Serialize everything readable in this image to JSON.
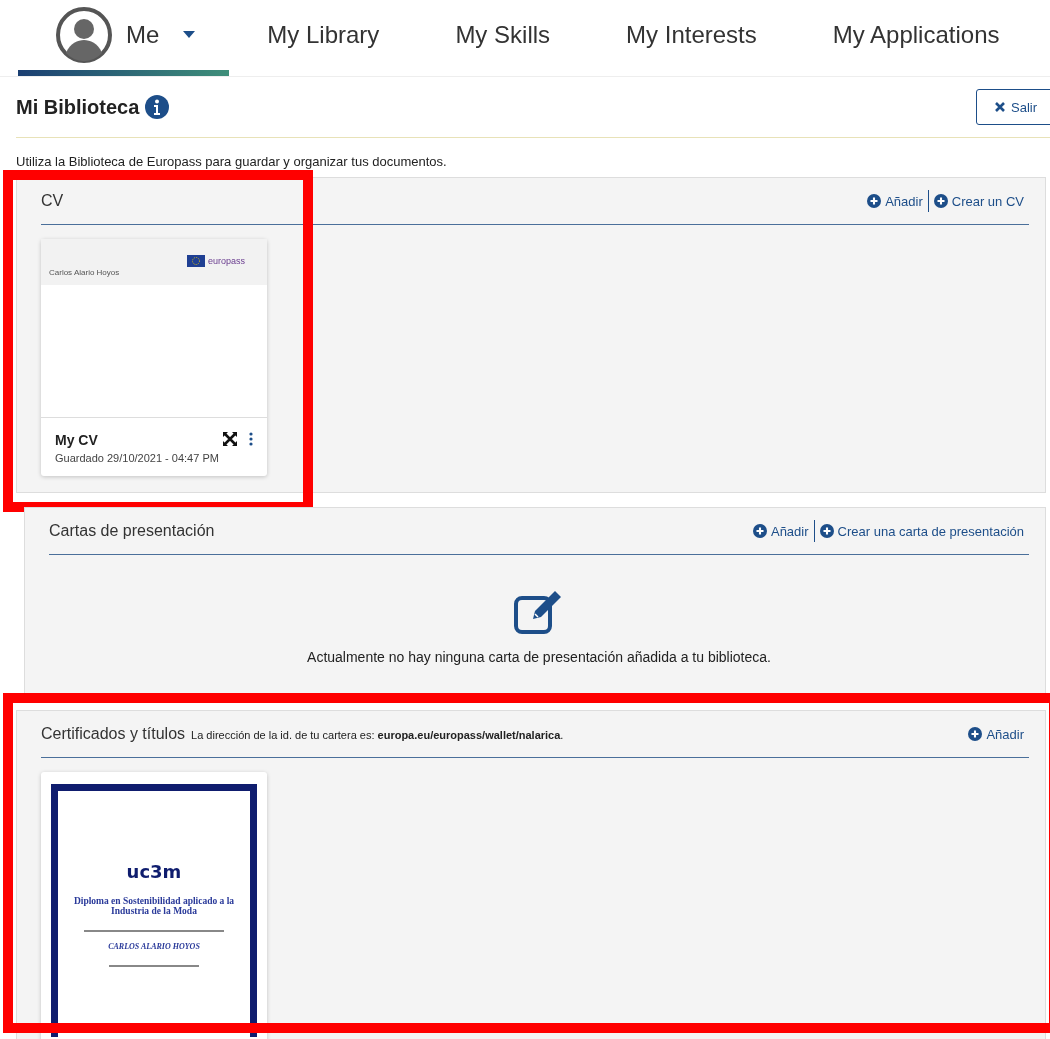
{
  "nav": {
    "tabs": [
      {
        "kind": "profile",
        "label": "Me",
        "selected": true
      },
      {
        "kind": "link",
        "label": "My Library",
        "selected": false
      },
      {
        "kind": "link",
        "label": "My Skills",
        "selected": false
      },
      {
        "kind": "link",
        "label": "My Interests",
        "selected": false
      },
      {
        "kind": "link",
        "label": "My Applications",
        "selected": false
      }
    ]
  },
  "page": {
    "title": "Mi Biblioteca",
    "close_button": "Salir",
    "intro": "Utiliza la Biblioteca de Europass para guardar y organizar tus documentos."
  },
  "sections": [
    {
      "kind": "cv",
      "title": "CV",
      "highlighted": true,
      "actions": [
        "Añadir",
        "Crear un CV"
      ],
      "cards": [
        {
          "kind": "cv",
          "preview_name": "Carlos Alario Hoyos",
          "preview_logo": "europass",
          "name": "My CV",
          "saved": "Guardado 29/10/2021 - 04:47 PM"
        }
      ]
    },
    {
      "kind": "letters",
      "title": "Cartas de presentación",
      "highlighted": false,
      "actions": [
        "Añadir",
        "Crear una carta de presentación"
      ],
      "empty_message": "Actualmente no hay ninguna carta de presentación añadida a tu biblioteca."
    },
    {
      "kind": "certificates",
      "title": "Certificados y títulos",
      "note": "La dirección de la id. de tu cartera es: **europa.eu/europass/wallet/nalarica**.",
      "highlighted": true,
      "actions": [
        "Añadir"
      ],
      "cards": [
        {
          "kind": "diploma",
          "logo": "uc3m",
          "title": "Diploma en Sostenibilidad aplicado a la Industria de la Moda",
          "holder": "CARLOS ALARIO HOYOS"
        }
      ]
    }
  ]
}
